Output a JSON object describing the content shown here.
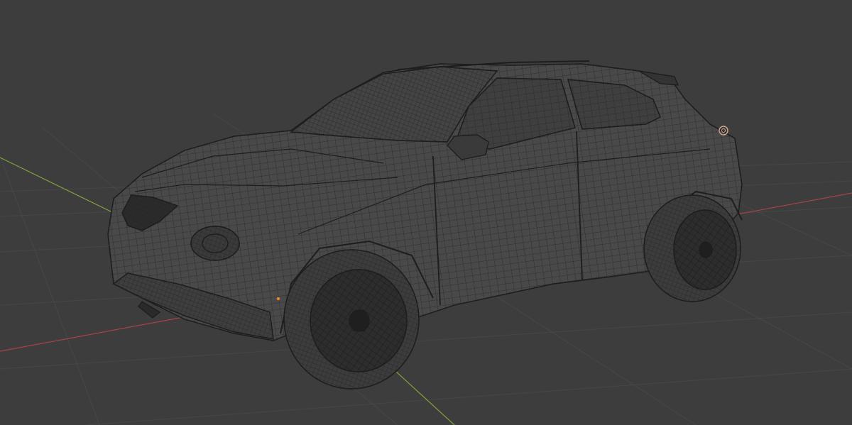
{
  "viewport": {
    "background": "#3d3d3d",
    "grid_color": "#4a4a4a",
    "axis_x_color": "#a8424a",
    "axis_y_color": "#7fa33c"
  },
  "model": {
    "wire_color": "#1f1f1f",
    "body_fill": "#4b4b4b",
    "origin_color": "#e88a2a"
  },
  "light_gizmo": {
    "icon": "light-icon",
    "color": "#d4a48a"
  }
}
